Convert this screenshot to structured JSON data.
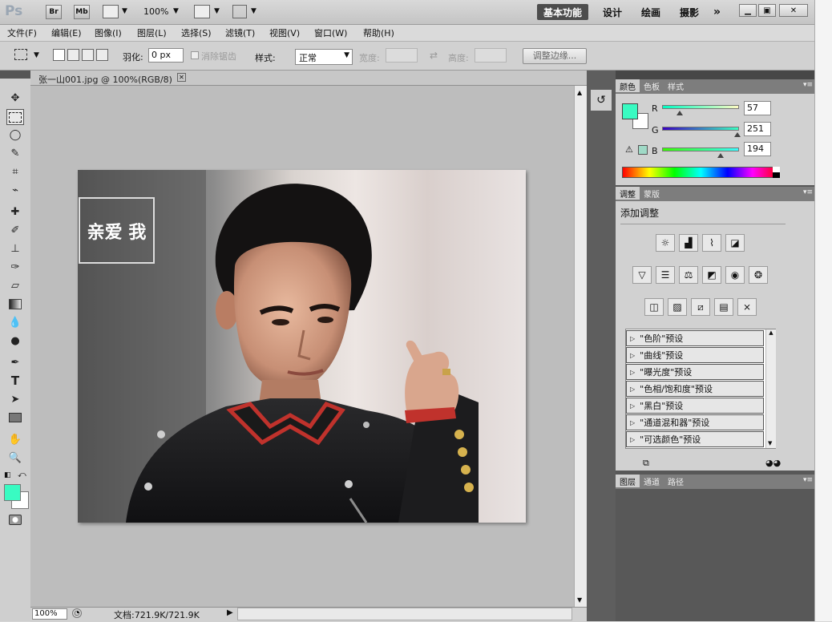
{
  "appbar": {
    "logo": "Ps",
    "bridge": "Br",
    "minibridge": "Mb",
    "zoom": "100%",
    "workspaces": [
      "基本功能",
      "设计",
      "绘画",
      "摄影"
    ],
    "more": "»"
  },
  "menu": [
    "文件(F)",
    "编辑(E)",
    "图像(I)",
    "图层(L)",
    "选择(S)",
    "滤镜(T)",
    "视图(V)",
    "窗口(W)",
    "帮助(H)"
  ],
  "options": {
    "feather_label": "羽化:",
    "feather_value": "0 px",
    "antialias_label": "消除锯齿",
    "style_label": "样式:",
    "style_value": "正常",
    "width_label": "宽度:",
    "height_label": "高度:",
    "refine_label": "调整边缘..."
  },
  "document": {
    "tab": "张一山001.jpg @ 100%(RGB/8)",
    "close": "✕",
    "logo_text": "亲爱 我"
  },
  "status": {
    "zoom": "100%",
    "doc": "文档:721.9K/721.9K"
  },
  "color_panel": {
    "tabs": [
      "颜色",
      "色板",
      "样式"
    ],
    "channels": [
      {
        "label": "R",
        "value": "57"
      },
      {
        "label": "G",
        "value": "251"
      },
      {
        "label": "B",
        "value": "194"
      }
    ],
    "fg_color": "#39fbc2"
  },
  "adjust_panel": {
    "tabs": [
      "调整",
      "蒙版"
    ],
    "title": "添加调整",
    "presets": [
      "\"色阶\"预设",
      "\"曲线\"预设",
      "\"曝光度\"预设",
      "\"色相/饱和度\"预设",
      "\"黑白\"预设",
      "\"通道混和器\"预设",
      "\"可选颜色\"预设"
    ]
  },
  "layers_panel": {
    "tabs": [
      "图层",
      "通道",
      "路径"
    ]
  }
}
